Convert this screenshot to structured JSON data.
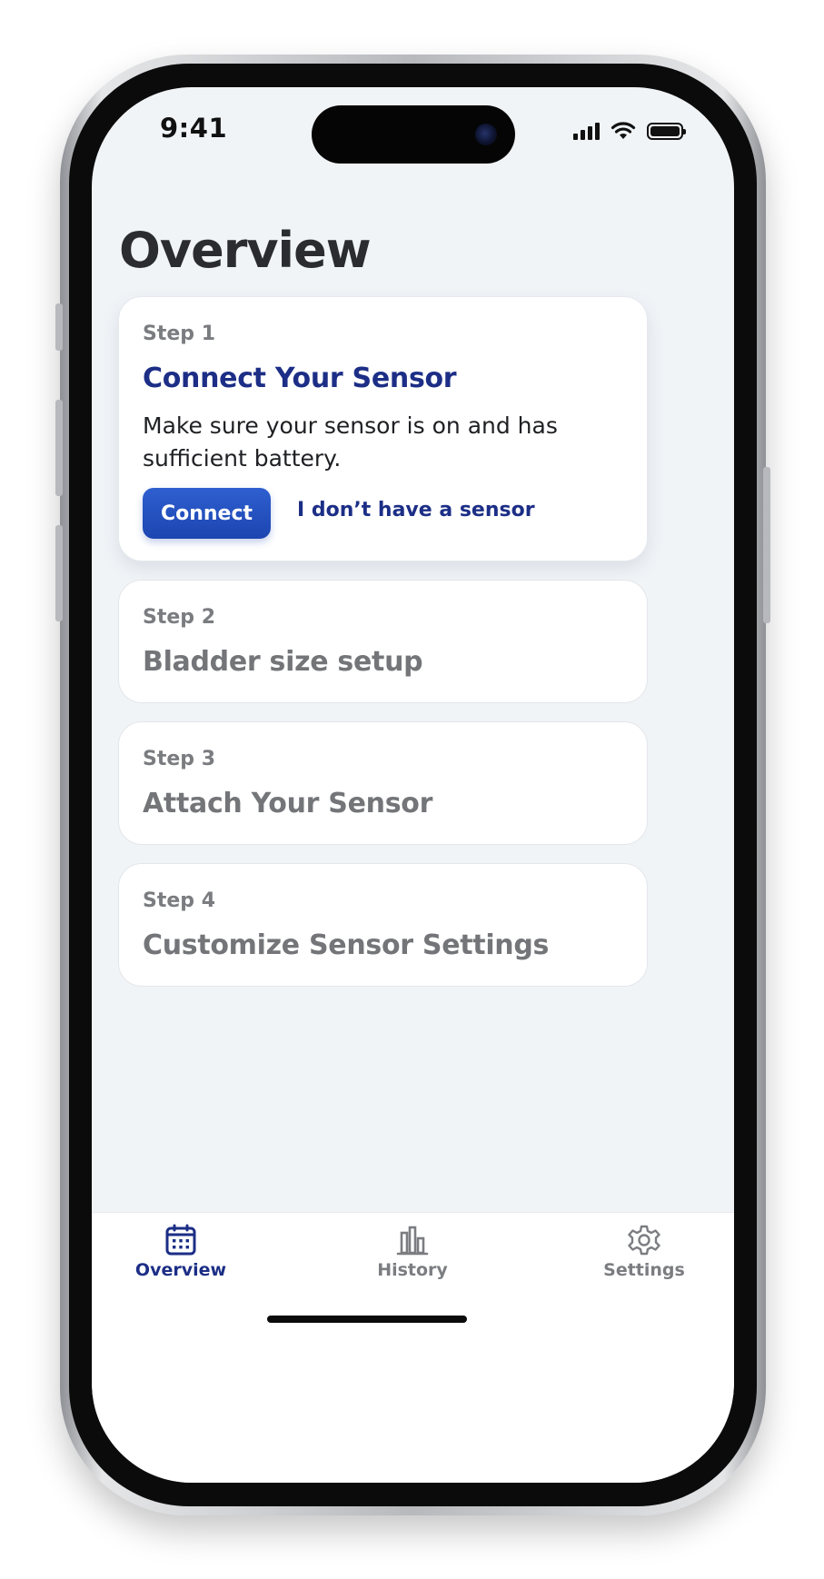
{
  "status_bar": {
    "time": "9:41"
  },
  "page": {
    "title": "Overview"
  },
  "steps": [
    {
      "label": "Step 1",
      "title": "Connect Your Sensor",
      "description": "Make sure your sensor is on and has sufficient battery.",
      "primary_action": "Connect",
      "secondary_action": "I don’t have a sensor",
      "active": true
    },
    {
      "label": "Step 2",
      "title": "Bladder size setup",
      "active": false
    },
    {
      "label": "Step 3",
      "title": "Attach Your Sensor",
      "active": false
    },
    {
      "label": "Step 4",
      "title": "Customize Sensor Settings",
      "active": false
    }
  ],
  "tabs": [
    {
      "label": "Overview",
      "icon": "calendar-icon",
      "selected": true
    },
    {
      "label": "History",
      "icon": "bar-chart-icon",
      "selected": false
    },
    {
      "label": "Settings",
      "icon": "gear-icon",
      "selected": false
    }
  ],
  "colors": {
    "primary": "#1C2E86",
    "button": "#2151C0",
    "background": "#F1F4F7",
    "inactive_text": "#737578"
  }
}
